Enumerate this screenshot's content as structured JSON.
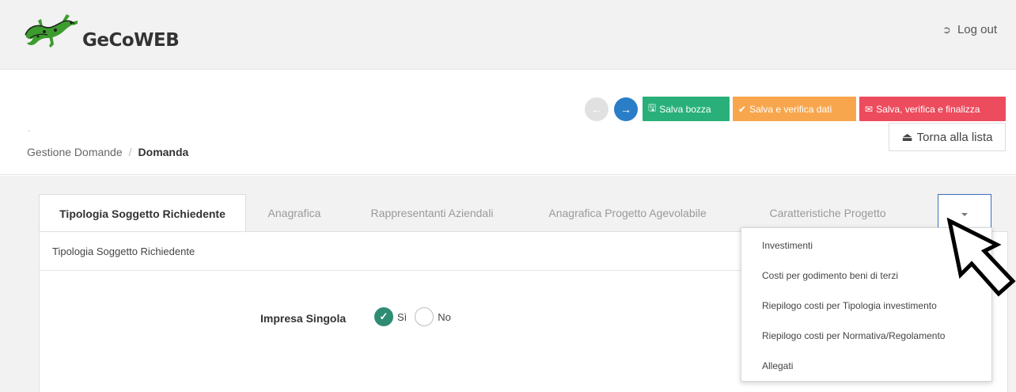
{
  "app": {
    "name": "GeCoWEB",
    "logout_label": "Log out"
  },
  "header": {
    "small_mark": ".",
    "breadcrumb": {
      "root": "Gestione Domande",
      "separator": "/",
      "current": "Domanda"
    },
    "nav": {
      "prev_icon": "arrow-left-icon",
      "next_icon": "arrow-right-icon"
    },
    "actions": {
      "save_draft": "Salva bozza",
      "save_verify": "Salva e verifica dati",
      "save_verify_finalize": "Salva, verifica e finalizza",
      "back_to_list": "Torna alla lista"
    }
  },
  "tabs": [
    {
      "label": "Tipologia Soggetto Richiedente",
      "active": true
    },
    {
      "label": "Anagrafica",
      "active": false
    },
    {
      "label": "Rappresentanti Aziendali",
      "active": false
    },
    {
      "label": "Anagrafica Progetto Agevolabile",
      "active": false
    },
    {
      "label": "Caratteristiche Progetto",
      "active": false
    }
  ],
  "dropdown": {
    "items": [
      "Investimenti",
      "Costi per godimento beni di terzi",
      "Riepilogo costi per Tipologia investimento",
      "Riepilogo costi per Normativa/Regolamento",
      "Allegati"
    ]
  },
  "panel": {
    "title": "Tipologia Soggetto Richiedente",
    "field_label": "Impresa Singola",
    "options": [
      {
        "label": "Sì",
        "checked": true
      },
      {
        "label": "No",
        "checked": false
      }
    ]
  },
  "colors": {
    "green": "#29b07a",
    "orange": "#f8a64d",
    "red": "#ec4c5e",
    "blue": "#2a7ec8",
    "radio_checked": "#2f8c73"
  }
}
